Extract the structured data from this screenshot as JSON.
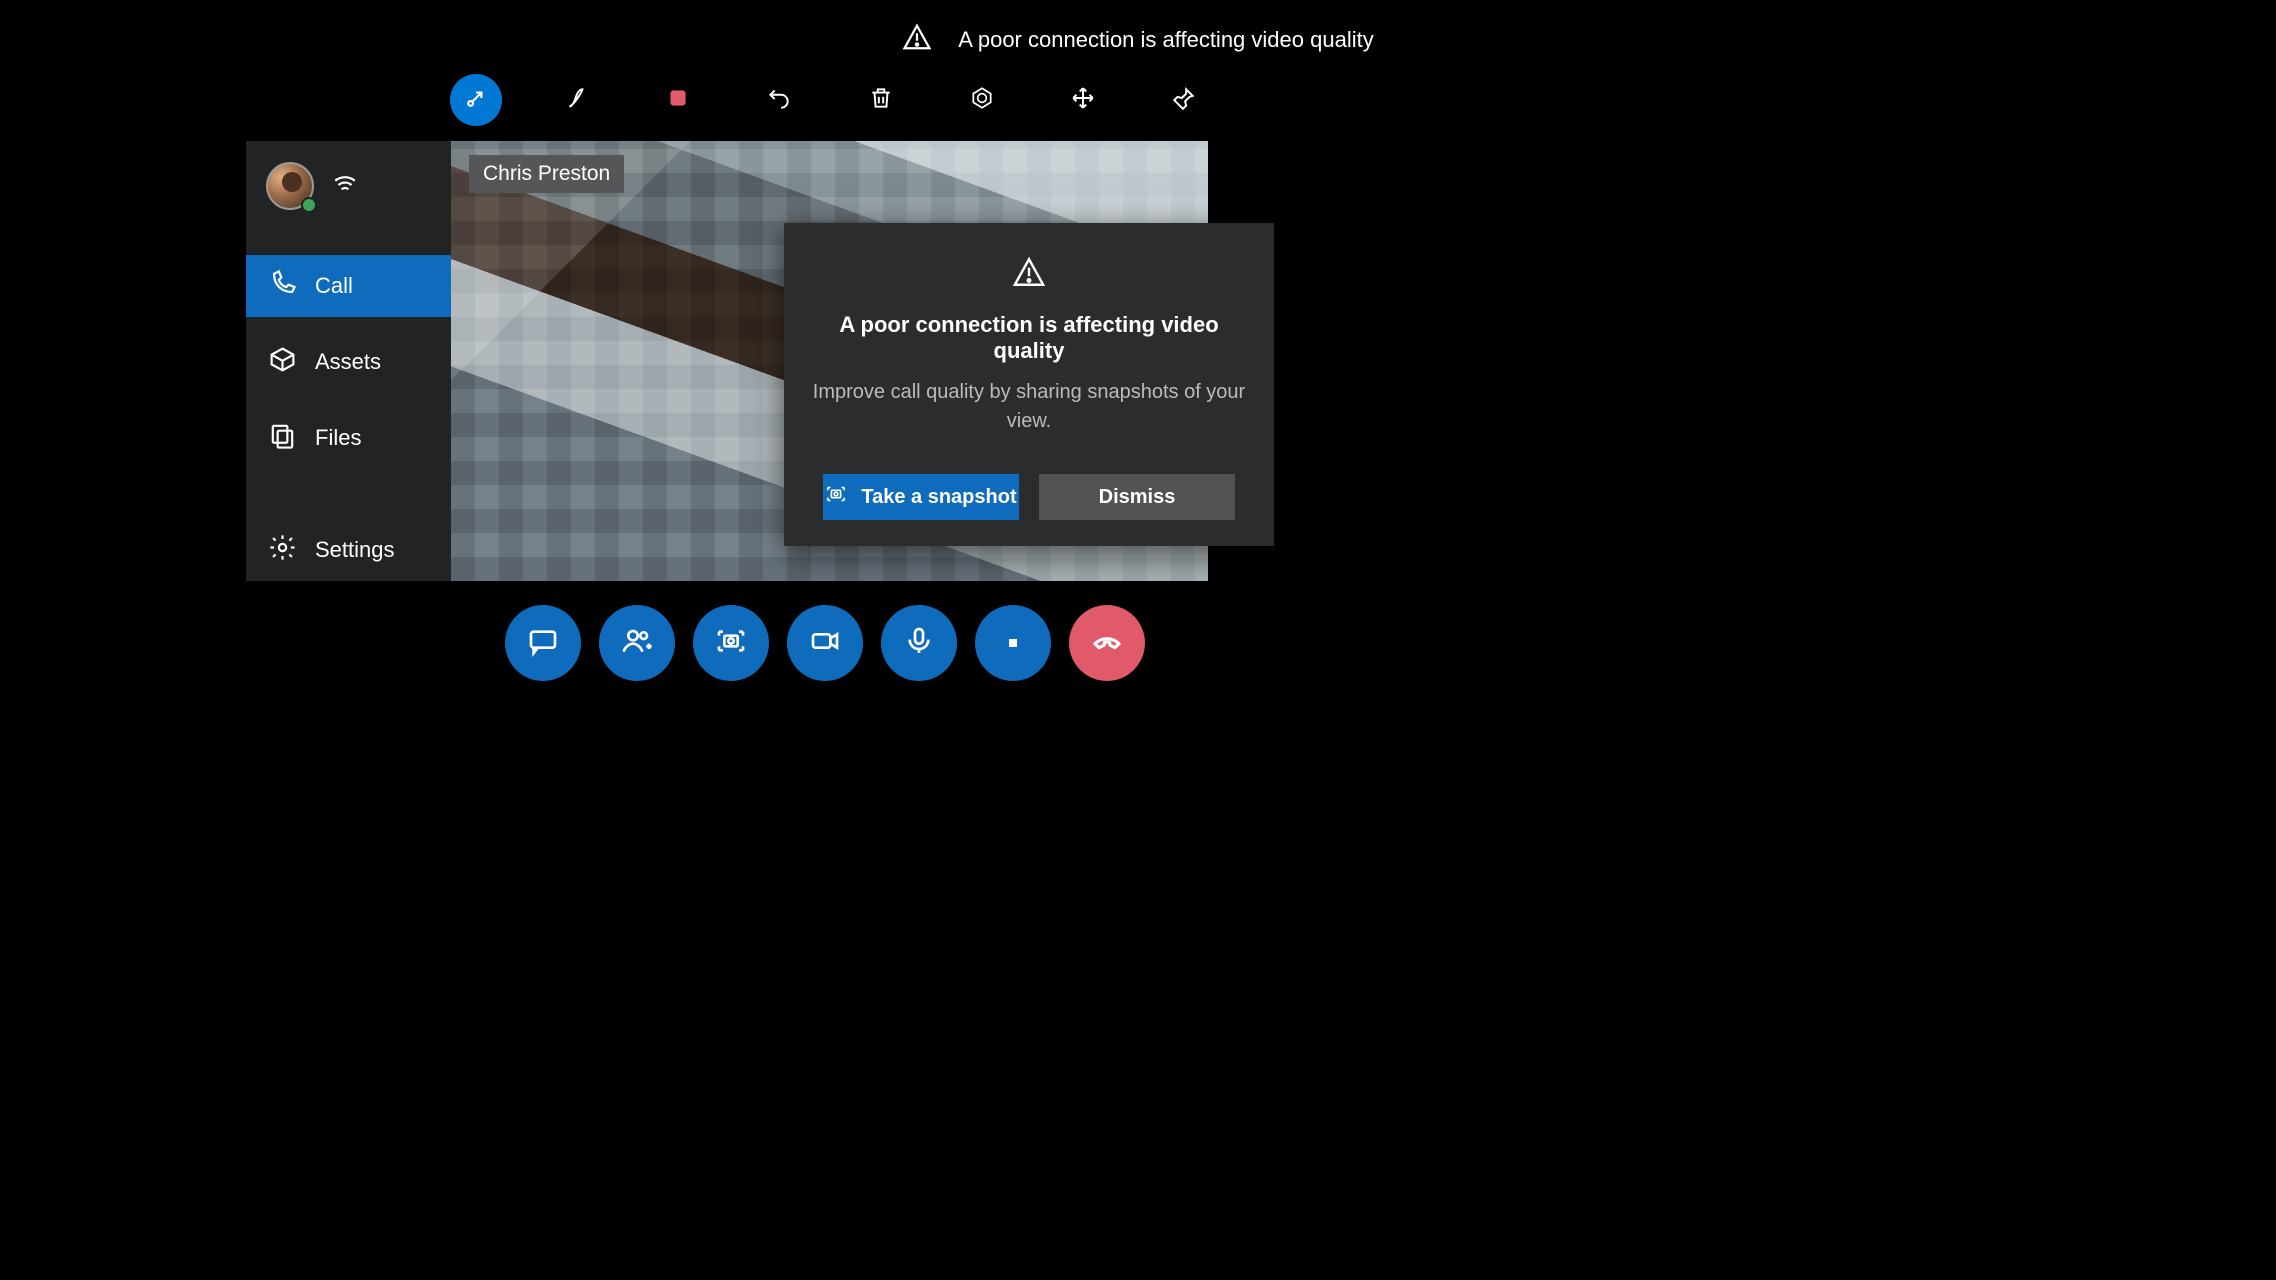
{
  "banner": {
    "text": "A poor connection is affecting video quality"
  },
  "toolbar": {
    "items": [
      {
        "name": "minimize-icon"
      },
      {
        "name": "ink-pen-icon"
      },
      {
        "name": "record-stop-icon"
      },
      {
        "name": "undo-icon"
      },
      {
        "name": "trash-icon"
      },
      {
        "name": "aperture-icon"
      },
      {
        "name": "move-arrows-icon"
      },
      {
        "name": "pin-icon"
      }
    ]
  },
  "sidebar": {
    "items": [
      {
        "label": "Call"
      },
      {
        "label": "Assets"
      },
      {
        "label": "Files"
      },
      {
        "label": "Settings"
      }
    ]
  },
  "call": {
    "remote_name": "Chris Preston"
  },
  "dialog": {
    "title": "A poor connection is affecting video quality",
    "subtitle": "Improve call quality by sharing snapshots of your view.",
    "primary_label": "Take a snapshot",
    "secondary_label": "Dismiss"
  },
  "controls": {
    "items": [
      {
        "name": "chat-icon"
      },
      {
        "name": "add-people-icon"
      },
      {
        "name": "snapshot-icon"
      },
      {
        "name": "video-icon"
      },
      {
        "name": "mic-icon"
      },
      {
        "name": "record-icon"
      },
      {
        "name": "hangup-icon"
      }
    ]
  },
  "colors": {
    "accent": "#0f6cbd",
    "danger": "#e05a6a",
    "panel": "#2b2c2e",
    "sidebar": "#222325"
  }
}
